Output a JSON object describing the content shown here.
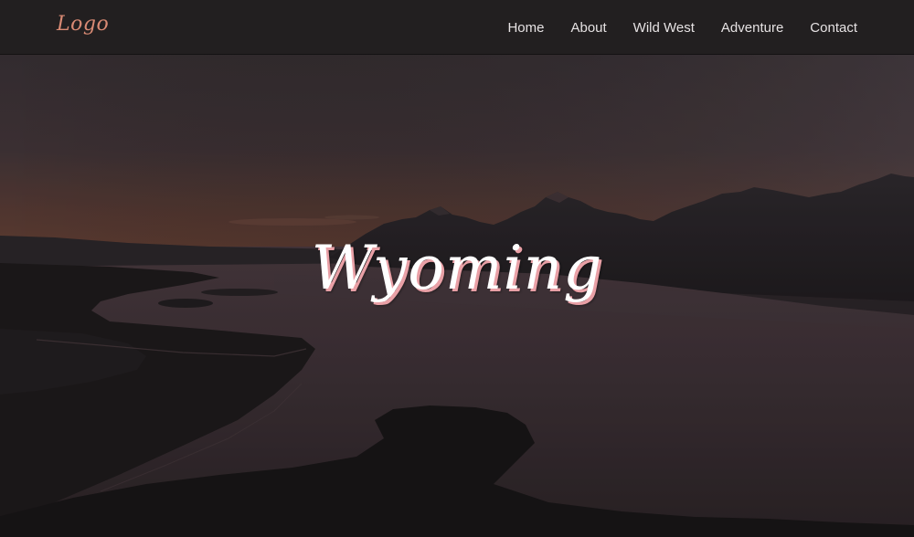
{
  "header": {
    "logo_text": "Logo",
    "nav_items": [
      {
        "label": "Home"
      },
      {
        "label": "About"
      },
      {
        "label": "Wild West"
      },
      {
        "label": "Adventure"
      },
      {
        "label": "Contact"
      }
    ]
  },
  "hero": {
    "title": "Wyoming",
    "image": "mountain-lake-dusk-landscape"
  },
  "colors": {
    "header_bg": "#221f20",
    "logo": "#d98a74",
    "nav_text": "#e6e2e3",
    "title": "#ffffff",
    "title_shadow": "#e9a0a6"
  }
}
